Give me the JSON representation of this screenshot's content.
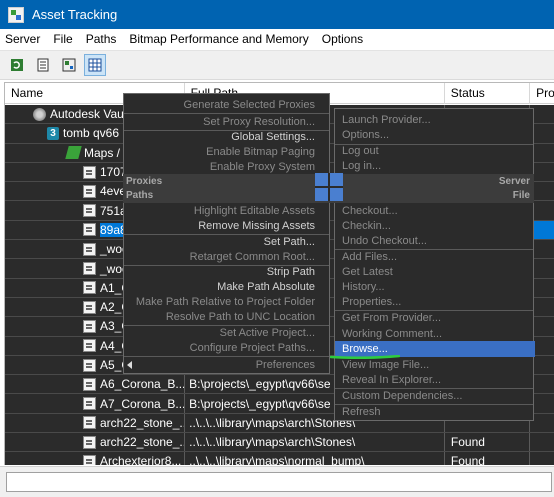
{
  "window": {
    "title": "Asset Tracking"
  },
  "menubar": [
    "Server",
    "File",
    "Paths",
    "Bitmap Performance and Memory",
    "Options"
  ],
  "toolbar": {
    "icons": [
      "refresh-icon",
      "list-icon",
      "thumbnail-icon",
      "table-view-icon"
    ]
  },
  "table": {
    "columns": [
      "Name",
      "Full Path",
      "Status",
      "Pro"
    ],
    "rows": [
      {
        "name": "Autodesk Vault",
        "path": "",
        "status": "",
        "icon": "vault-icon"
      },
      {
        "name": "tomb qv66",
        "path": "",
        "status": "",
        "icon": "scene-icon"
      },
      {
        "name": "Maps / S",
        "path": "",
        "status": "",
        "icon": "folder-icon"
      },
      {
        "name": "1707",
        "path": "",
        "status": "",
        "icon": "file-icon"
      },
      {
        "name": "4eve",
        "path": "",
        "status": "",
        "icon": "file-icon"
      },
      {
        "name": "751a",
        "path": "",
        "status": "",
        "icon": "file-icon"
      },
      {
        "name": "89a8",
        "path": "",
        "status": "",
        "icon": "file-icon",
        "selected": true
      },
      {
        "name": "_woo",
        "path": "",
        "status": "",
        "icon": "file-icon"
      },
      {
        "name": "_woo",
        "path": "",
        "status": "",
        "icon": "file-icon"
      },
      {
        "name": "A1_C",
        "path": "",
        "status": "",
        "icon": "file-icon"
      },
      {
        "name": "A2_C",
        "path": "",
        "status": "",
        "icon": "file-icon"
      },
      {
        "name": "A3_C",
        "path": "",
        "status": "",
        "icon": "file-icon"
      },
      {
        "name": "A4_C",
        "path": "",
        "status": "",
        "icon": "file-icon"
      },
      {
        "name": "A5_C",
        "path": "",
        "status": "",
        "icon": "file-icon"
      },
      {
        "name": "A6_Corona_B...",
        "path": "B:\\projects\\_egypt\\qv66\\se",
        "status": "",
        "icon": "file-icon"
      },
      {
        "name": "A7_Corona_B...",
        "path": "B:\\projects\\_egypt\\qv66\\se",
        "status": "",
        "icon": "file-icon"
      },
      {
        "name": "arch22_stone_...",
        "path": "..\\..\\..\\library\\maps\\arch\\Stones\\",
        "status": "",
        "icon": "file-icon"
      },
      {
        "name": "arch22_stone_...",
        "path": "..\\..\\..\\library\\maps\\arch\\Stones\\",
        "status": "Found",
        "icon": "file-icon"
      },
      {
        "name": "Archexterior8...",
        "path": "..\\..\\..\\library\\maps\\normal_bump\\",
        "status": "Found",
        "icon": "file-icon"
      }
    ]
  },
  "context_menu": {
    "left": {
      "items1": [
        {
          "label": "Generate Selected Proxies",
          "enabled": false
        },
        {
          "label": "Set Proxy Resolution...",
          "enabled": false
        },
        {
          "label": "Global Settings...",
          "enabled": true
        },
        {
          "label": "Enable Bitmap Paging",
          "enabled": false
        },
        {
          "label": "Enable Proxy System",
          "enabled": false
        }
      ],
      "section_proxies": "Proxies",
      "section_paths": "Paths",
      "items2": [
        {
          "label": "Highlight Editable Assets",
          "enabled": false
        },
        {
          "label": "Remove Missing Assets",
          "enabled": true
        },
        {
          "label": "Set Path...",
          "enabled": true
        },
        {
          "label": "Retarget Common Root...",
          "enabled": false
        },
        {
          "label": "Strip Path",
          "enabled": true
        },
        {
          "label": "Make Path Absolute",
          "enabled": true
        },
        {
          "label": "Make Path Relative to Project Folder",
          "enabled": false
        },
        {
          "label": "Resolve Path to UNC Location",
          "enabled": false
        },
        {
          "label": "Set Active Project...",
          "enabled": false
        },
        {
          "label": "Configure Project Paths...",
          "enabled": false
        },
        {
          "label": "Preferences",
          "enabled": false
        }
      ]
    },
    "right": {
      "items1": [
        {
          "label": "Launch Provider...",
          "enabled": false
        },
        {
          "label": "Options...",
          "enabled": false
        },
        {
          "label": "Log out",
          "enabled": false
        },
        {
          "label": "Log in...",
          "enabled": false
        }
      ],
      "section_server": "Server",
      "section_file": "File",
      "items2": [
        {
          "label": "Checkout...",
          "enabled": false
        },
        {
          "label": "Checkin...",
          "enabled": false
        },
        {
          "label": "Undo Checkout...",
          "enabled": false
        },
        {
          "label": "Add Files...",
          "enabled": false
        },
        {
          "label": "Get Latest",
          "enabled": false
        },
        {
          "label": "History...",
          "enabled": false
        },
        {
          "label": "Properties...",
          "enabled": false
        },
        {
          "label": "Get From Provider...",
          "enabled": false
        },
        {
          "label": "Working Comment...",
          "enabled": false
        },
        {
          "label": "Browse...",
          "enabled": true,
          "highlighted": true
        },
        {
          "label": "View Image File...",
          "enabled": false
        },
        {
          "label": "Reveal In Explorer...",
          "enabled": false
        },
        {
          "label": "Custom Dependencies...",
          "enabled": false
        },
        {
          "label": "Refresh",
          "enabled": false
        }
      ]
    }
  },
  "colors": {
    "titlebar": "#0063b1",
    "menu_bg": "#2b2b2b",
    "highlight": "#3a6fc4",
    "selection": "#0078d7",
    "annotation": "#2ecc40"
  }
}
